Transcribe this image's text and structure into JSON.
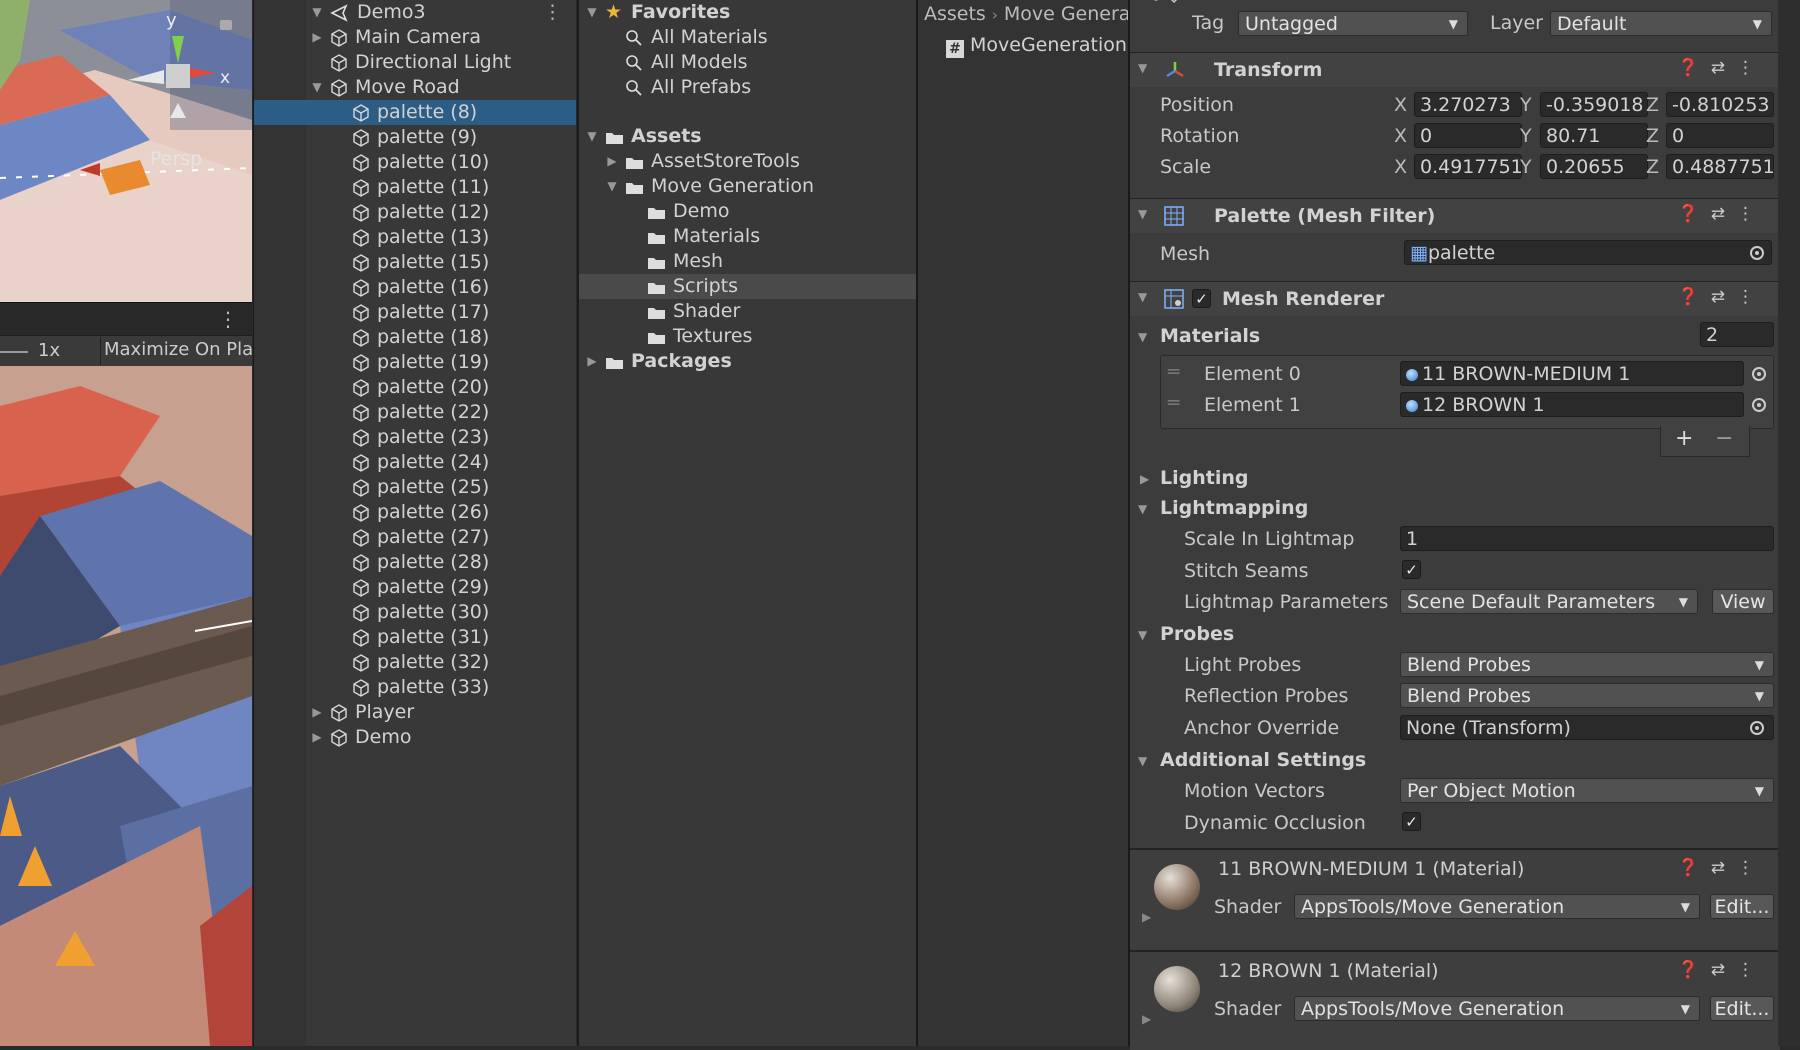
{
  "scene_view": {
    "axis_y": "y",
    "axis_x": "x",
    "persp_label": "Persp"
  },
  "game_toolbar": {
    "scale_label": "1x",
    "maximize_label": "Maximize On Pla"
  },
  "hierarchy": {
    "scene_name": "Demo3",
    "items": [
      {
        "label": "Main Camera"
      },
      {
        "label": "Directional Light"
      },
      {
        "label": "Move Road"
      },
      {
        "label": "palette (8)"
      },
      {
        "label": "palette (9)"
      },
      {
        "label": "palette (10)"
      },
      {
        "label": "palette (11)"
      },
      {
        "label": "palette (12)"
      },
      {
        "label": "palette (13)"
      },
      {
        "label": "palette (15)"
      },
      {
        "label": "palette (16)"
      },
      {
        "label": "palette (17)"
      },
      {
        "label": "palette (18)"
      },
      {
        "label": "palette (19)"
      },
      {
        "label": "palette (20)"
      },
      {
        "label": "palette (22)"
      },
      {
        "label": "palette (23)"
      },
      {
        "label": "palette (24)"
      },
      {
        "label": "palette (25)"
      },
      {
        "label": "palette (26)"
      },
      {
        "label": "palette (27)"
      },
      {
        "label": "palette (28)"
      },
      {
        "label": "palette (29)"
      },
      {
        "label": "palette (30)"
      },
      {
        "label": "palette (31)"
      },
      {
        "label": "palette (32)"
      },
      {
        "label": "palette (33)"
      },
      {
        "label": "Player"
      },
      {
        "label": "Demo"
      }
    ]
  },
  "project": {
    "favorites_label": "Favorites",
    "favorites": [
      {
        "label": "All Materials"
      },
      {
        "label": "All Models"
      },
      {
        "label": "All Prefabs"
      }
    ],
    "assets_label": "Assets",
    "asset_store_tools": "AssetStoreTools",
    "move_generation": "Move Generation",
    "subfolders": [
      {
        "label": "Demo"
      },
      {
        "label": "Materials"
      },
      {
        "label": "Mesh"
      },
      {
        "label": "Scripts"
      },
      {
        "label": "Shader"
      },
      {
        "label": "Textures"
      }
    ],
    "packages_label": "Packages",
    "breadcrumb": [
      "Assets",
      "Move Genera"
    ],
    "file_name": "MoveGenerationS",
    "script_glyph": "#"
  },
  "inspector": {
    "tag_label": "Tag",
    "tag_value": "Untagged",
    "layer_label": "Layer",
    "layer_value": "Default",
    "transform": {
      "title": "Transform",
      "position_label": "Position",
      "rotation_label": "Rotation",
      "scale_label": "Scale",
      "x": "X",
      "y": "Y",
      "z": "Z",
      "position": [
        "3.270273",
        "-0.359018",
        "-0.810253"
      ],
      "rotation": [
        "0",
        "80.71",
        "0"
      ],
      "scale": [
        "0.4917751",
        "0.20655",
        "0.4887751"
      ]
    },
    "mesh_filter": {
      "title": "Palette (Mesh Filter)",
      "mesh_label": "Mesh",
      "mesh_value": "palette"
    },
    "mesh_renderer": {
      "title": "Mesh Renderer",
      "materials_label": "Materials",
      "materials_count": "2",
      "elements": [
        {
          "label": "Element 0",
          "value": "11 BROWN-MEDIUM 1"
        },
        {
          "label": "Element 1",
          "value": "12 BROWN 1"
        }
      ],
      "plus": "+",
      "minus": "−",
      "lighting_label": "Lighting",
      "lightmapping_label": "Lightmapping",
      "scale_in_lightmap_label": "Scale In Lightmap",
      "scale_in_lightmap_value": "1",
      "stitch_seams_label": "Stitch Seams",
      "lightmap_params_label": "Lightmap Parameters",
      "lightmap_params_value": "Scene Default Parameters",
      "view_button": "View",
      "probes_label": "Probes",
      "light_probes_label": "Light Probes",
      "light_probes_value": "Blend Probes",
      "reflection_probes_label": "Reflection Probes",
      "reflection_probes_value": "Blend Probes",
      "anchor_override_label": "Anchor Override",
      "anchor_override_value": "None (Transform)",
      "additional_label": "Additional Settings",
      "motion_vectors_label": "Motion Vectors",
      "motion_vectors_value": "Per Object Motion",
      "dynamic_occlusion_label": "Dynamic Occlusion"
    },
    "materials": [
      {
        "title": "11 BROWN-MEDIUM 1 (Material)",
        "shader_label": "Shader",
        "shader_value": "AppsTools/Move Generation",
        "edit_button": "Edit...",
        "color": "#8a7360"
      },
      {
        "title": "12 BROWN 1 (Material)",
        "shader_label": "Shader",
        "shader_value": "AppsTools/Move Generation",
        "edit_button": "Edit...",
        "color": "#8f8578"
      }
    ]
  },
  "colors": {
    "selection": "#2c5d87",
    "panel": "#383838",
    "inspector": "#3c3c3c"
  }
}
